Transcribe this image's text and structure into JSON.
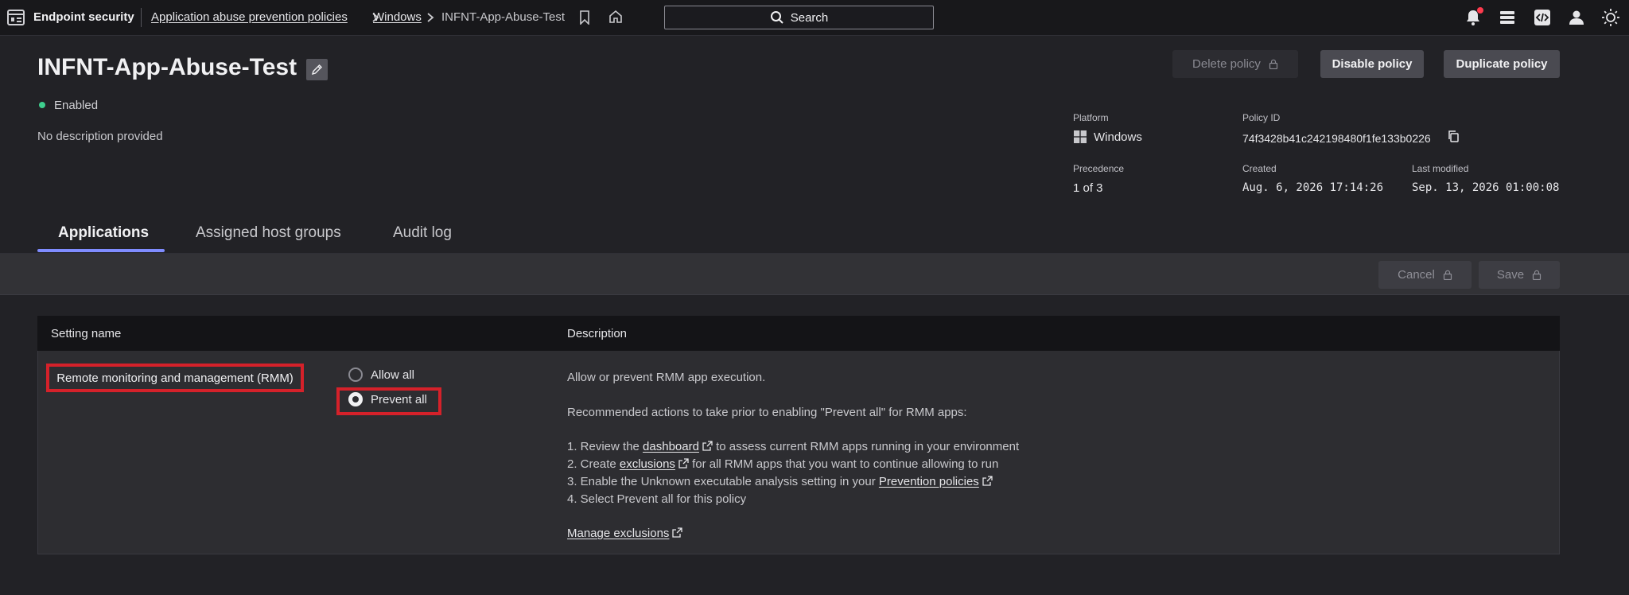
{
  "topbar": {
    "app_name": "Endpoint security",
    "breadcrumb": [
      "Application abuse prevention policies",
      "Windows",
      "INFNT-App-Abuse-Test"
    ],
    "search_label": "Search"
  },
  "header": {
    "title": "INFNT-App-Abuse-Test",
    "status": "Enabled",
    "description": "No description provided",
    "buttons": {
      "delete": "Delete policy",
      "disable": "Disable policy",
      "duplicate": "Duplicate policy"
    },
    "meta": {
      "platform_label": "Platform",
      "platform_value": "Windows",
      "policy_id_label": "Policy ID",
      "policy_id_value": "74f3428b41c242198480f1fe133b0226",
      "precedence_label": "Precedence",
      "precedence_value": "1 of 3",
      "created_label": "Created",
      "created_value": "Aug. 6, 2026 17:14:26",
      "modified_label": "Last modified",
      "modified_value": "Sep. 13, 2026 01:00:08"
    }
  },
  "tabs": [
    {
      "label": "Applications",
      "active": true
    },
    {
      "label": "Assigned host groups",
      "active": false
    },
    {
      "label": "Audit log",
      "active": false
    }
  ],
  "actions": {
    "cancel": "Cancel",
    "save": "Save"
  },
  "table": {
    "col_setting": "Setting name",
    "col_description": "Description",
    "row": {
      "setting_name": "Remote monitoring and management (RMM)",
      "options": [
        "Allow all",
        "Prevent all"
      ],
      "selected": "Prevent all",
      "desc_intro": "Allow or prevent RMM app execution.",
      "desc_recommend": "Recommended actions to take prior to enabling \"Prevent all\" for RMM apps:",
      "step1_pre": "1. Review the ",
      "step1_link": "dashboard",
      "step1_post": " to assess current RMM apps running in your environment",
      "step2_pre": "2. Create ",
      "step2_link": "exclusions",
      "step2_post": " for all RMM apps that you want to continue allowing to run",
      "step3_pre": "3. Enable the Unknown executable analysis setting in your ",
      "step3_link": "Prevention policies",
      "step4": "4. Select Prevent all for this policy",
      "manage_link": "Manage exclusions"
    }
  },
  "colors": {
    "accent_tab": "#7f8cff",
    "status_enabled": "#3ecf8e",
    "highlight_box": "#d5212a",
    "notification_dot": "#ff3b4e"
  }
}
